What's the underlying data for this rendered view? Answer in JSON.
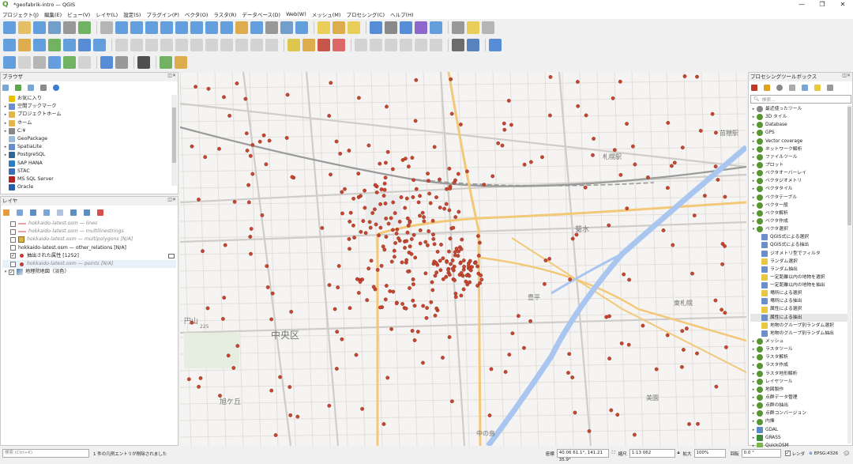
{
  "window": {
    "title": "*geofabrik-intro — QGIS"
  },
  "menu": [
    "プロジェクト(J)",
    "編集(E)",
    "ビュー(V)",
    "レイヤ(L)",
    "設定(S)",
    "プラグイン(P)",
    "ベクタ(O)",
    "ラスタ(R)",
    "データベース(D)",
    "Web(W)",
    "メッシュ(M)",
    "プロセシング(C)",
    "ヘルプ(H)"
  ],
  "browser": {
    "title": "ブラウザ",
    "items": [
      {
        "label": "お気に入り",
        "icon": "star-icon",
        "color": "#e8c000"
      },
      {
        "label": "空間ブックマーク",
        "icon": "bookmark-icon",
        "color": "#6b8fc9"
      },
      {
        "label": "プロジェクトホーム",
        "icon": "folder-icon",
        "color": "#e2b64d"
      },
      {
        "label": "ホーム",
        "icon": "folder-icon",
        "color": "#e2b64d"
      },
      {
        "label": "C:¥",
        "icon": "drive-icon",
        "color": "#888888"
      },
      {
        "label": "GeoPackage",
        "icon": "geopackage-icon",
        "color": "#9bbbd9"
      },
      {
        "label": "SpatiaLite",
        "icon": "spatialite-icon",
        "color": "#6a8dc7"
      },
      {
        "label": "PostgreSQL",
        "icon": "postgres-icon",
        "color": "#336791"
      },
      {
        "label": "SAP HANA",
        "icon": "sap-icon",
        "color": "#2f7bc4"
      },
      {
        "label": "STAC",
        "icon": "stac-icon",
        "color": "#3b6eb5"
      },
      {
        "label": "MS SQL Server",
        "icon": "mssql-icon",
        "color": "#b22222"
      },
      {
        "label": "Oracle",
        "icon": "oracle-icon",
        "color": "#2a5caa"
      }
    ]
  },
  "layers": {
    "title": "レイヤ",
    "items": [
      {
        "label": "hokkaido-latest.osm — lines",
        "checked": false,
        "italic": true,
        "symbol": "line",
        "color": "#e8a0a0"
      },
      {
        "label": "hokkaido-latest.osm — multilinestrings",
        "checked": false,
        "italic": true,
        "symbol": "line",
        "color": "#e8a0a0"
      },
      {
        "label": "hokkaido-latest.osm — multipolygons [N/A]",
        "checked": false,
        "italic": true,
        "symbol": "poly",
        "color": "#d9b34a"
      },
      {
        "label": "hokkaido-latest.osm — other_relations [N/A]",
        "checked": false,
        "italic": false,
        "symbol": "none",
        "color": "#ffffff"
      },
      {
        "label": "抽出された属性 [1252]",
        "checked": true,
        "italic": false,
        "symbol": "point",
        "color": "#c0392b"
      },
      {
        "label": "hokkaido-latest.osm — points [N/A]",
        "checked": false,
        "italic": true,
        "symbol": "point",
        "color": "#c0392b"
      },
      {
        "label": "地理院地図（淡色）",
        "checked": true,
        "italic": false,
        "symbol": "raster",
        "color": "#4a7fc1"
      }
    ]
  },
  "toolbox": {
    "title": "プロセシングツールボックス",
    "search_placeholder": "検索...",
    "items": [
      {
        "label": "最近使ったツール",
        "level": 0,
        "icon": "clock-icon"
      },
      {
        "label": "3D タイル",
        "level": 0,
        "icon": "qgis-icon"
      },
      {
        "label": "Database",
        "level": 0,
        "icon": "qgis-icon"
      },
      {
        "label": "GPS",
        "level": 0,
        "icon": "qgis-icon"
      },
      {
        "label": "Vector coverage",
        "level": 0,
        "icon": "qgis-icon"
      },
      {
        "label": "ネットワーク解析",
        "level": 0,
        "icon": "qgis-icon"
      },
      {
        "label": "ファイルツール",
        "level": 0,
        "icon": "qgis-icon"
      },
      {
        "label": "プロット",
        "level": 0,
        "icon": "qgis-icon"
      },
      {
        "label": "ベクタオーバーレイ",
        "level": 0,
        "icon": "qgis-icon"
      },
      {
        "label": "ベクタジオメトリ",
        "level": 0,
        "icon": "qgis-icon"
      },
      {
        "label": "ベクタタイル",
        "level": 0,
        "icon": "qgis-icon"
      },
      {
        "label": "ベクタテーブル",
        "level": 0,
        "icon": "qgis-icon"
      },
      {
        "label": "ベクター般",
        "level": 0,
        "icon": "qgis-icon"
      },
      {
        "label": "ベクタ解析",
        "level": 0,
        "icon": "qgis-icon"
      },
      {
        "label": "ベクタ作成",
        "level": 0,
        "icon": "qgis-icon"
      },
      {
        "label": "ベクタ選択",
        "level": 0,
        "icon": "qgis-icon",
        "expanded": true
      },
      {
        "label": "QGIS式による選択",
        "level": 1,
        "icon": "gear-icon"
      },
      {
        "label": "QGIS式による抽出",
        "level": 1,
        "icon": "gear-icon"
      },
      {
        "label": "ジオメトリ型でフィルタ",
        "level": 1,
        "icon": "gear-icon"
      },
      {
        "label": "ランダム選択",
        "level": 1,
        "icon": "select-icon"
      },
      {
        "label": "ランダム抽出",
        "level": 1,
        "icon": "gear-icon"
      },
      {
        "label": "一定距離以内の地物を選択",
        "level": 1,
        "icon": "select-icon"
      },
      {
        "label": "一定距離以内の地物を抽出",
        "level": 1,
        "icon": "gear-icon"
      },
      {
        "label": "場所による選択",
        "level": 1,
        "icon": "select-icon"
      },
      {
        "label": "場所による抽出",
        "level": 1,
        "icon": "gear-icon"
      },
      {
        "label": "属性による選択",
        "level": 1,
        "icon": "select-icon"
      },
      {
        "label": "属性による抽出",
        "level": 1,
        "icon": "gear-icon",
        "selected": true
      },
      {
        "label": "地物のグループ別ランダム選択",
        "level": 1,
        "icon": "select-icon"
      },
      {
        "label": "地物のグループ別ランダム抽出",
        "level": 1,
        "icon": "gear-icon"
      },
      {
        "label": "メッシュ",
        "level": 0,
        "icon": "qgis-icon"
      },
      {
        "label": "ラスタツール",
        "level": 0,
        "icon": "qgis-icon"
      },
      {
        "label": "ラスタ解析",
        "level": 0,
        "icon": "qgis-icon"
      },
      {
        "label": "ラスタ作成",
        "level": 0,
        "icon": "qgis-icon"
      },
      {
        "label": "ラスタ地形解析",
        "level": 0,
        "icon": "qgis-icon"
      },
      {
        "label": "レイヤツール",
        "level": 0,
        "icon": "qgis-icon"
      },
      {
        "label": "地図製作",
        "level": 0,
        "icon": "qgis-icon"
      },
      {
        "label": "点群データ管理",
        "level": 0,
        "icon": "qgis-icon"
      },
      {
        "label": "点群の抽出",
        "level": 0,
        "icon": "qgis-icon"
      },
      {
        "label": "点群コンバージョン",
        "level": 0,
        "icon": "qgis-icon"
      },
      {
        "label": "内挿",
        "level": 0,
        "icon": "qgis-icon"
      },
      {
        "label": "GDAL",
        "level": 0,
        "icon": "gdal-icon"
      },
      {
        "label": "GRASS",
        "level": 0,
        "icon": "grass-icon"
      },
      {
        "label": "QuickOSM",
        "level": 0,
        "icon": "quickosm-icon"
      }
    ]
  },
  "map": {
    "labels": [
      "中央区",
      "円山",
      "旭ケ丘",
      "札幌駅",
      "苗穂駅",
      "菊水",
      "豊平",
      "東札幌",
      "美園",
      "中の島",
      "225"
    ]
  },
  "status": {
    "search_placeholder": "検索 (Ctrl+K)",
    "message": "1 件の凡例エントリが削除されました",
    "coord_label": "座標",
    "coord_value": "40.06 61.1°, 141.21 35.9°",
    "scale_label": "縮尺",
    "scale_value": "1:13 062",
    "magnifier_label": "拡大",
    "magnifier_value": "100%",
    "rotation_label": "回転",
    "rotation_value": "0.0 °",
    "render_label": "レンダ",
    "crs_value": "EPSG:4326"
  }
}
